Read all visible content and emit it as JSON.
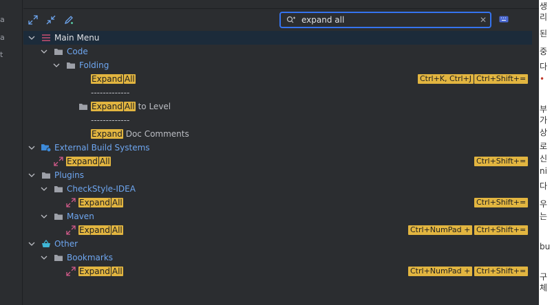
{
  "left_strip": {
    "labels": [
      "a",
      "a",
      "t"
    ]
  },
  "right_strip": {
    "labels": [
      "생",
      "리",
      "된",
      "중",
      "다",
      "•",
      "부",
      "가",
      "상",
      "로",
      "신",
      "ni",
      "다",
      "우",
      "는",
      "bu",
      "구",
      "체"
    ]
  },
  "toolbar": {
    "expand_icon": "expand-all-icon",
    "collapse_icon": "collapse-all-icon",
    "edit_icon": "edit-icon"
  },
  "search": {
    "value": "expand all",
    "placeholder": "",
    "clear_glyph": "✕"
  },
  "tree": {
    "main_menu": "Main Menu",
    "code": "Code",
    "folding": "Folding",
    "expand_all_1": {
      "h1": "Expand",
      "h2": "All"
    },
    "shortcut_ctrl_k": "Ctrl+K, Ctrl+J",
    "shortcut_ctrl_shift": "Ctrl+Shift+=",
    "separator": "-------------",
    "expand_all_to_level": {
      "h1": "Expand",
      "h2": "All",
      "rest": " to Level"
    },
    "expand_doc": {
      "h1": "Expand",
      "rest": " Doc Comments"
    },
    "external_build": "External Build Systems",
    "plugins": "Plugins",
    "checkstyle": "CheckStyle-IDEA",
    "maven": "Maven",
    "shortcut_numpad": "Ctrl+NumPad +",
    "other": "Other",
    "bookmarks": "Bookmarks",
    "expand_word": "Expand",
    "all_word": "All"
  }
}
